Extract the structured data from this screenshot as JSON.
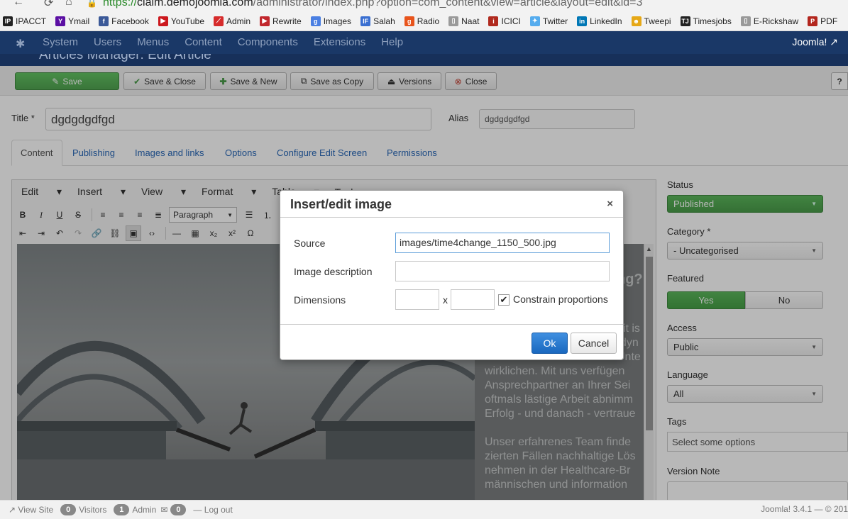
{
  "browser": {
    "url_secure": "https://",
    "url_host": "claim.demojoomla.com",
    "url_rest": "/administrator/index.php?option=com_content&view=article&layout=edit&id=3",
    "bookmarks": [
      {
        "label": "IPACCT",
        "icon": "ip-icon",
        "color": "#222222"
      },
      {
        "label": "Ymail",
        "icon": "yahoo-icon",
        "color": "#5b0fa3"
      },
      {
        "label": "Facebook",
        "icon": "facebook-icon",
        "color": "#3b5998"
      },
      {
        "label": "YouTube",
        "icon": "youtube-icon",
        "color": "#cc181e"
      },
      {
        "label": "Admin",
        "icon": "chart-icon",
        "color": "#d62b2b"
      },
      {
        "label": "Rewrite",
        "icon": "play-icon",
        "color": "#c1272d"
      },
      {
        "label": "Images",
        "icon": "google-icon",
        "color": "#4a7fe2"
      },
      {
        "label": "Salah",
        "icon": "if-icon",
        "color": "#3a6fd1"
      },
      {
        "label": "Radio",
        "icon": "g-icon",
        "color": "#e8541c"
      },
      {
        "label": "Naat",
        "icon": "page-icon",
        "color": "#9a9a9a"
      },
      {
        "label": "ICICI",
        "icon": "icici-icon",
        "color": "#b02a1e"
      },
      {
        "label": "Twitter",
        "icon": "twitter-icon",
        "color": "#55acee"
      },
      {
        "label": "LinkedIn",
        "icon": "linkedin-icon",
        "color": "#0077b5"
      },
      {
        "label": "Tweepi",
        "icon": "tweepi-icon",
        "color": "#e6a817"
      },
      {
        "label": "Timesjobs",
        "icon": "tj-icon",
        "color": "#222222"
      },
      {
        "label": "E-Rickshaw",
        "icon": "page-icon",
        "color": "#9a9a9a"
      },
      {
        "label": "PDF",
        "icon": "pdf-icon",
        "color": "#b3261e"
      }
    ]
  },
  "topnav": {
    "menu": [
      "System",
      "Users",
      "Menus",
      "Content",
      "Components",
      "Extensions",
      "Help"
    ],
    "brand": "Joomla!",
    "page_heading": "Articles Manager: Edit Article"
  },
  "toolbar": {
    "save": "Save",
    "save_close": "Save & Close",
    "save_new": "Save & New",
    "save_copy": "Save as Copy",
    "versions": "Versions",
    "close": "Close",
    "help": "?"
  },
  "form": {
    "title_label": "Title *",
    "title_value": "dgdgdgdfgd",
    "alias_label": "Alias",
    "alias_value": "dgdgdgdfgd"
  },
  "tabs": [
    "Content",
    "Publishing",
    "Images and links",
    "Options",
    "Configure Edit Screen",
    "Permissions"
  ],
  "editor": {
    "menus": [
      "Edit",
      "Insert",
      "View",
      "Format",
      "Table",
      "Tools"
    ],
    "format_select": "Paragraph",
    "content_lines": [
      "ng?",
      "eit is",
      "dyn",
      "Unte",
      "wirklichen. Mit uns verfügen",
      "Ansprechpartner an Ihrer Sei",
      "oftmals lästige Arbeit abnimm",
      "Erfolg - und danach - vertraue",
      "",
      "Unser erfahrenes Team finde",
      "zierten Fällen nachhaltige Lös",
      "nehmen in der Healthcare-Br",
      "männischen und information"
    ]
  },
  "sidebar": {
    "status_label": "Status",
    "status_value": "Published",
    "category_label": "Category *",
    "category_value": "- Uncategorised",
    "featured_label": "Featured",
    "featured_yes": "Yes",
    "featured_no": "No",
    "access_label": "Access",
    "access_value": "Public",
    "language_label": "Language",
    "language_value": "All",
    "tags_label": "Tags",
    "tags_placeholder": "Select some options",
    "version_note_label": "Version Note"
  },
  "dialog": {
    "title": "Insert/edit image",
    "close": "×",
    "source_label": "Source",
    "source_value": "images/time4change_1150_500.jpg",
    "description_label": "Image description",
    "description_value": "",
    "dimensions_label": "Dimensions",
    "width_value": "",
    "height_value": "",
    "dim_separator": "x",
    "constrain_label": "Constrain proportions",
    "constrain_checked": true,
    "ok": "Ok",
    "cancel": "Cancel"
  },
  "statusbar": {
    "view_site": "View Site",
    "visitors_count": "0",
    "visitors_label": "Visitors",
    "admin_count": "1",
    "admin_label": "Admin",
    "messages_count": "0",
    "logout": "Log out",
    "version": "Joomla! 3.4.1 — © 201"
  },
  "colors": {
    "topnav_bg": "#1a3867",
    "save_green": "#51a351",
    "ok_blue": "#1a68bf",
    "link_blue": "#2a69b8"
  }
}
